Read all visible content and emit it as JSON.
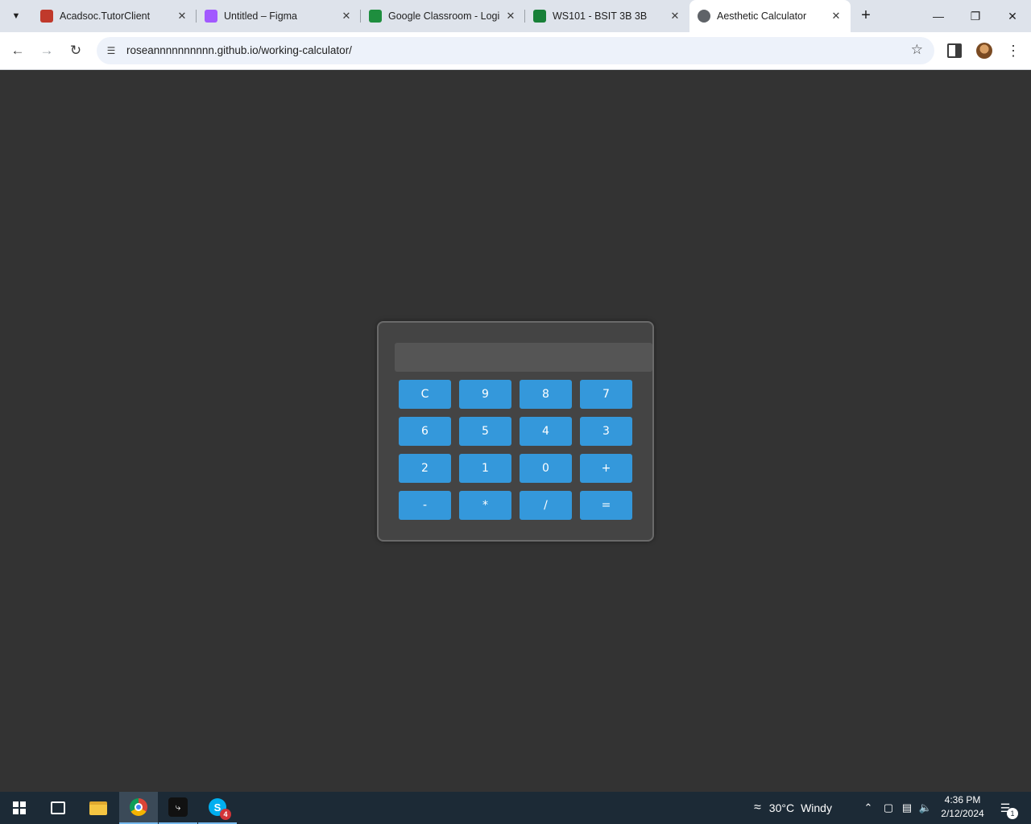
{
  "browser": {
    "tabs": [
      {
        "title": "Acadsoc.TutorClient",
        "favicon_color": "#c0392b",
        "active": false
      },
      {
        "title": "Untitled – Figma",
        "favicon_color": "#a259ff",
        "active": false
      },
      {
        "title": "Google Classroom - Logi",
        "favicon_color": "#1e8e3e",
        "active": false
      },
      {
        "title": "WS101 - BSIT 3B 3B",
        "favicon_color": "#188038",
        "active": false
      },
      {
        "title": "Aesthetic Calculator",
        "favicon_color": "#5f6368",
        "active": true
      }
    ],
    "url": "roseannnnnnnnnn.github.io/working-calculator/",
    "icons": {
      "tab_search": "chevron-down-icon",
      "back": "back-arrow-icon",
      "forward": "forward-arrow-icon",
      "reload": "reload-icon",
      "site_info": "tune-icon",
      "bookmark": "star-icon",
      "side_panel": "side-panel-icon",
      "menu": "kebab-menu-icon"
    }
  },
  "calculator": {
    "display_value": "",
    "keys": [
      "C",
      "9",
      "8",
      "7",
      "6",
      "5",
      "4",
      "3",
      "2",
      "1",
      "0",
      "+",
      "-",
      "*",
      "/",
      "="
    ],
    "colors": {
      "background": "#333333",
      "panel": "#444444",
      "display": "#555555",
      "key": "#3498db"
    }
  },
  "taskbar": {
    "weather": {
      "temp": "30°C",
      "condition": "Windy"
    },
    "time": "4:36 PM",
    "date": "2/12/2024",
    "skype_badge": "4",
    "notification_count": "1"
  }
}
